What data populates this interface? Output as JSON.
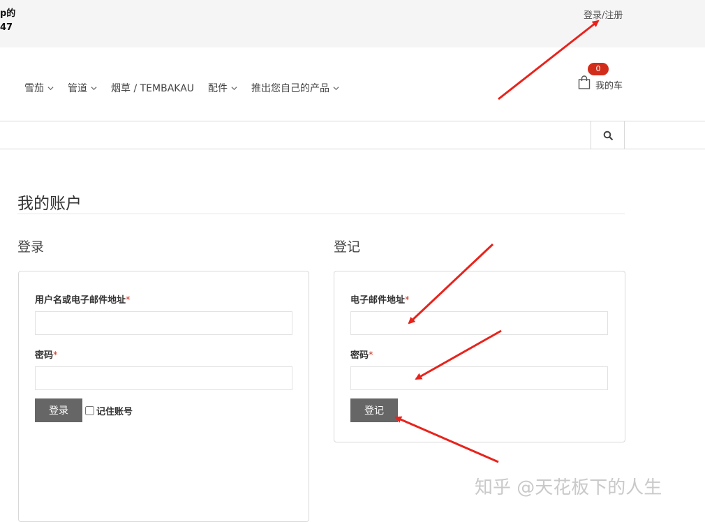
{
  "topbar": {
    "left_line1": "p的",
    "left_line2": "47",
    "login_register": "登录/注册"
  },
  "nav": {
    "items": [
      {
        "label": "雪茄",
        "has_dropdown": true
      },
      {
        "label": "管道",
        "has_dropdown": true
      },
      {
        "label": "烟草 / TEMBAKAU",
        "has_dropdown": false
      },
      {
        "label": "配件",
        "has_dropdown": true
      },
      {
        "label": "推出您自己的产品",
        "has_dropdown": true
      }
    ]
  },
  "cart": {
    "count": "0",
    "label": "我的车",
    "icon": "shopping-bag-icon"
  },
  "search": {
    "placeholder": "",
    "icon": "search-icon"
  },
  "page": {
    "title": "我的账户"
  },
  "login": {
    "heading": "登录",
    "username_label": "用户名或电子邮件地址",
    "password_label": "密码",
    "required_mark": "*",
    "submit_label": "登录",
    "remember_label": "记住账号"
  },
  "register": {
    "heading": "登记",
    "email_label": "电子邮件地址",
    "password_label": "密码",
    "required_mark": "*",
    "submit_label": "登记"
  },
  "watermark": "知乎 @天花板下的人生",
  "colors": {
    "accent": "#d22d1b",
    "button": "#666666",
    "topbar_bg": "#f5f5f5",
    "annotation_arrow": "#e8231c"
  }
}
